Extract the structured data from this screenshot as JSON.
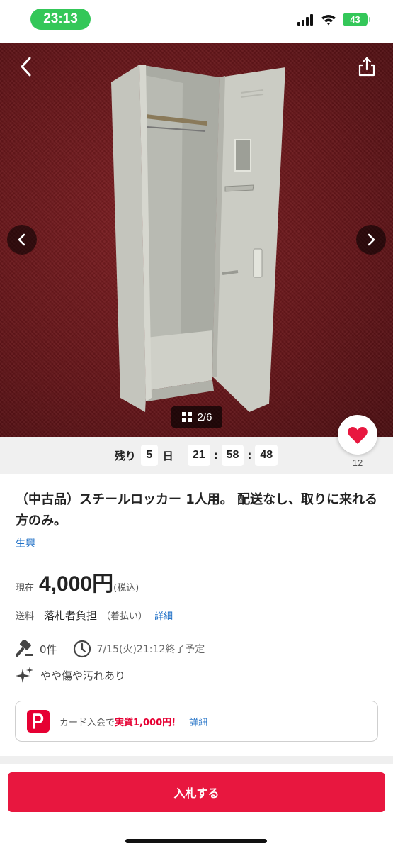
{
  "status_bar": {
    "time": "23:13",
    "battery": "43"
  },
  "gallery": {
    "counter": "2/6",
    "icons": [
      "back-chevron-icon",
      "share-icon",
      "prev-arrow-icon",
      "next-arrow-icon",
      "grid-icon"
    ]
  },
  "countdown": {
    "prefix": "残り",
    "days": "5",
    "days_unit": "日",
    "hours": "21",
    "minutes": "58",
    "seconds": "48",
    "separator": ":"
  },
  "favorite": {
    "count": "12",
    "color": "#e8173f"
  },
  "item": {
    "title": "（中古品）スチールロッカー 1人用。 配送なし、取りに来れる方のみ。",
    "seller": "生興",
    "price_label": "現在",
    "price": "4,000円",
    "price_tax": "(税込)",
    "shipping_label": "送料",
    "shipping_value": "落札者負担",
    "shipping_note": "（着払い）",
    "shipping_detail": "詳細",
    "bids": "0件",
    "end_time": "7/15(火)21:12終了予定",
    "condition": "やや傷や汚れあり"
  },
  "promo": {
    "text": "カード入会で",
    "highlight": "実質1,000円！",
    "detail": "詳細"
  },
  "bid_button": {
    "label": "入札する",
    "color": "#e8173f"
  },
  "colors": {
    "accent": "#e8173f",
    "link": "#1e6fc6",
    "status_green": "#34c759"
  }
}
